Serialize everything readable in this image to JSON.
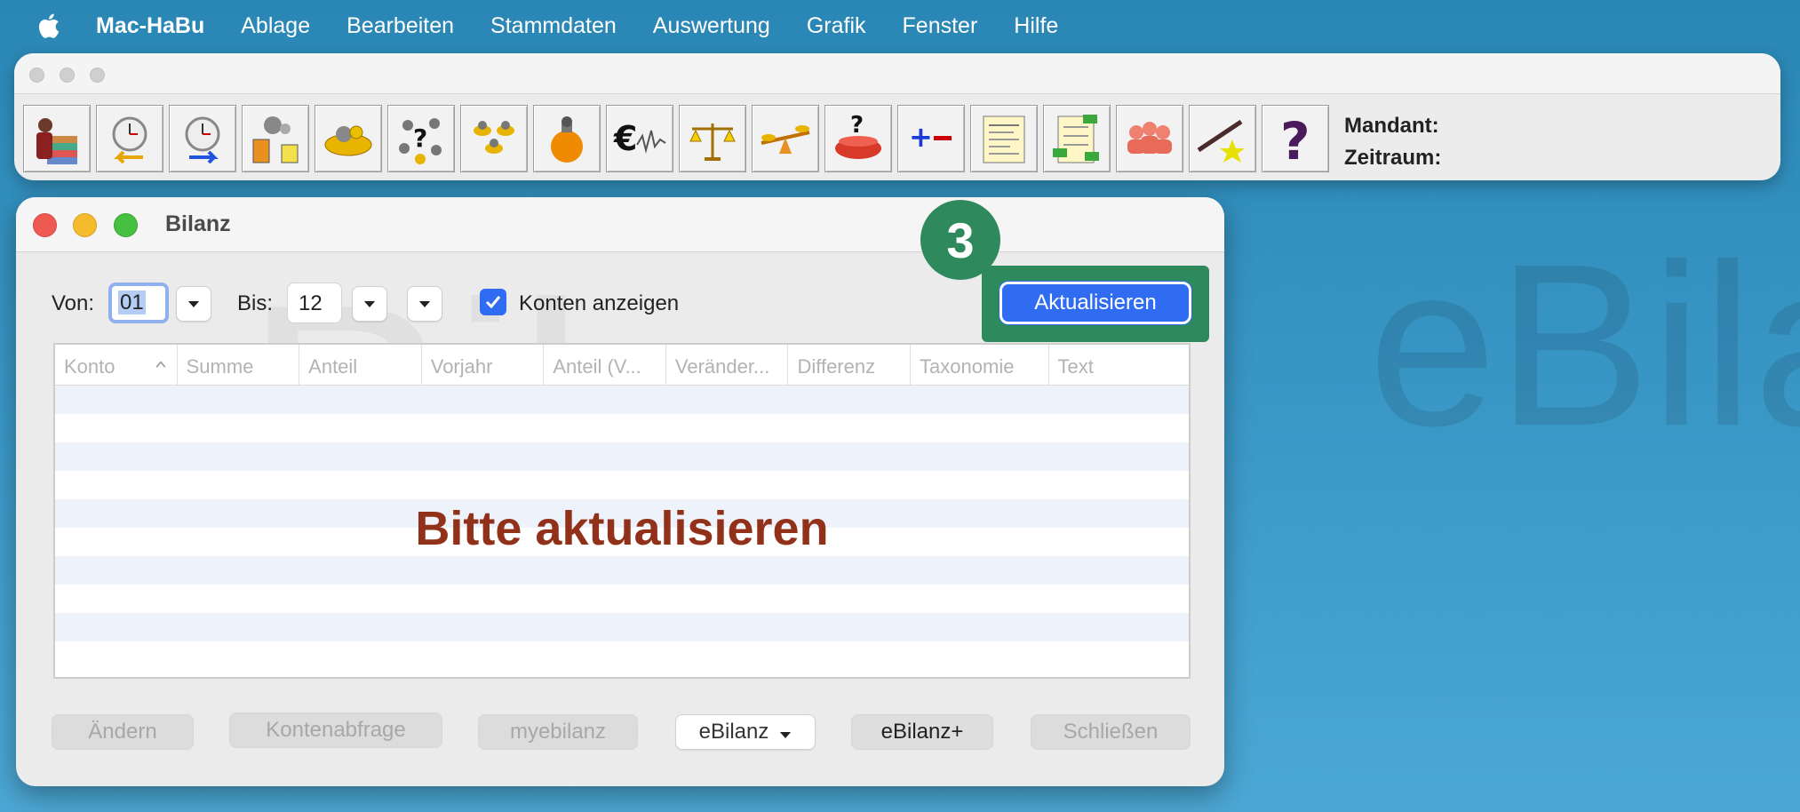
{
  "menubar": {
    "app_name": "Mac-HaBu",
    "items": [
      "Ablage",
      "Bearbeiten",
      "Stammdaten",
      "Auswertung",
      "Grafik",
      "Fenster",
      "Hilfe"
    ]
  },
  "toolbar": {
    "icons": [
      "books-person-icon",
      "clock-back-icon",
      "clock-forward-icon",
      "transfer-icon",
      "coin-bowl-icon",
      "question-balls-icon",
      "balls-icon",
      "money-bag-icon",
      "euro-chart-icon",
      "scale-icon",
      "seesaw-icon",
      "pot-question-icon",
      "plus-minus-icon",
      "report-icon",
      "document-money-icon",
      "people-icon",
      "wand-icon",
      "help-icon"
    ],
    "mandant_label": "Mandant:",
    "zeitraum_label": "Zeitraum:"
  },
  "window": {
    "title": "Bilanz",
    "von_label": "Von:",
    "von_value": "01",
    "bis_label": "Bis:",
    "bis_value": "12",
    "konten_label": "Konten anzeigen",
    "konten_checked": true,
    "aktualisieren_label": "Aktualisieren",
    "step_badge": "3",
    "watermark": "eBilanz",
    "columns": [
      "Konto",
      "Summe",
      "Anteil",
      "Vorjahr",
      "Anteil (V...",
      "Veränder...",
      "Differenz",
      "Taxonomie",
      "Text"
    ],
    "empty_message": "Bitte aktualisieren",
    "buttons": {
      "aendern": "Ändern",
      "kontenabfrage": "Kontenabfrage",
      "myebilanz": "myebilanz",
      "ebilanz": "eBilanz",
      "ebilanz_plus": "eBilanz+",
      "schliessen": "Schließen"
    }
  },
  "desktop": {
    "watermark": "eBilanz+"
  },
  "colors": {
    "accent": "#2f6cf2",
    "highlight": "#2e8a5d",
    "empty_message": "#92311a"
  }
}
